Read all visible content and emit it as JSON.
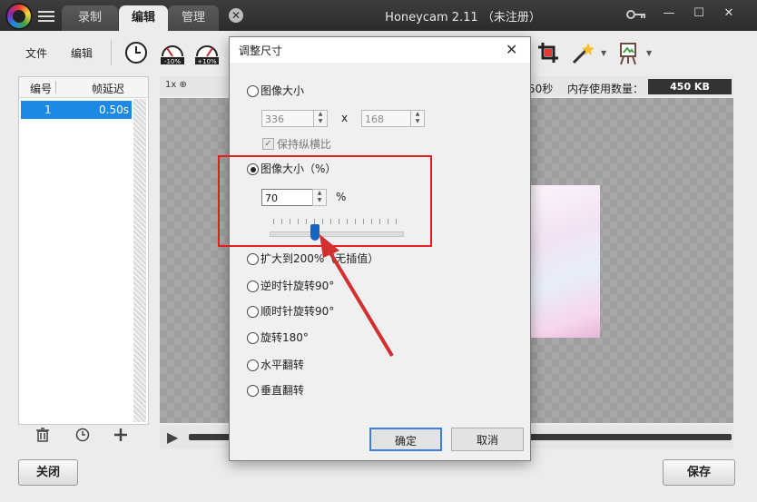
{
  "window": {
    "title": "Honeycam 2.11 （未注册）",
    "tabs": [
      {
        "label": "录制",
        "active": false
      },
      {
        "label": "编辑",
        "active": true
      },
      {
        "label": "管理",
        "active": false
      }
    ],
    "controls": {
      "minimize": "—",
      "maximize": "☐",
      "close": "✕",
      "close_tab": "✕"
    }
  },
  "toolbar": {
    "file_label": "文件",
    "edit_label": "编辑",
    "slow_badge": "-10%",
    "fast_badge": "+10%",
    "icons": [
      "speed-icon",
      "slow-down-icon",
      "speed-up-icon",
      "crop-icon",
      "magic-wand-icon",
      "easel-icon"
    ]
  },
  "frames": {
    "columns": [
      "编号",
      "帧延迟"
    ],
    "rows": [
      {
        "no": "1",
        "delay": "0.50s"
      }
    ]
  },
  "canvas": {
    "zoom_label": "1x",
    "duration_suffix": "50秒",
    "memory_label": "内存使用数量：",
    "memory_value": "450 KB"
  },
  "dialog": {
    "title": "调整尺寸",
    "option_image_size": "图像大小",
    "width_value": "336",
    "times_sign": "x",
    "height_value": "168",
    "keep_ratio_label": "保持纵横比",
    "keep_ratio_checked": true,
    "option_percent": "图像大小（%）",
    "percent_value": "70",
    "percent_unit": "%",
    "percent_slider_level": 70,
    "option_enlarge": "扩大到200%（无插值）",
    "option_ccw": "逆时针旋转90°",
    "option_cw": "顺时针旋转90°",
    "option_rot180": "旋转180°",
    "option_hflip": "水平翻转",
    "option_vflip": "垂直翻转",
    "selected_option": "option_percent",
    "ok_label": "确定",
    "cancel_label": "取消"
  },
  "bottom": {
    "close_label": "关闭",
    "save_label": "保存"
  },
  "colors": {
    "accent": "#1e88e5",
    "highlight": "#e02020",
    "titlebar": "#2c2c2c"
  }
}
